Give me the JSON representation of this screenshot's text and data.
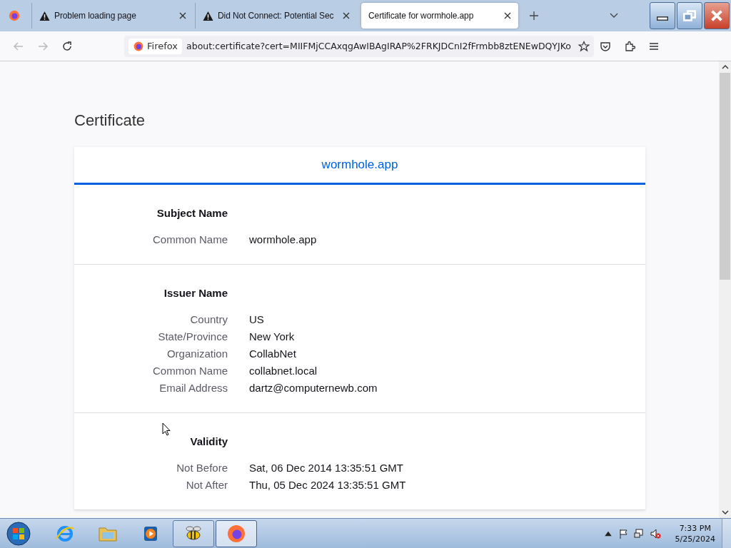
{
  "tabs": [
    {
      "title": "Problem loading page",
      "warning": true,
      "selected": false
    },
    {
      "title": "Did Not Connect: Potential Sec",
      "warning": true,
      "selected": false
    },
    {
      "title": "Certificate for wormhole.app",
      "warning": false,
      "selected": true
    }
  ],
  "nav": {
    "identity": "Firefox",
    "url": "about:certificate?cert=MIIFMjCCAxqgAwIBAgIRAP%2FRKJDCnI2fFrmbb8ztENEwDQYJKo"
  },
  "page": {
    "title": "Certificate",
    "cert_tab": "wormhole.app",
    "sections": [
      {
        "heading": "Subject Name",
        "rows": [
          {
            "label": "Common Name",
            "value": "wormhole.app"
          }
        ]
      },
      {
        "heading": "Issuer Name",
        "rows": [
          {
            "label": "Country",
            "value": "US"
          },
          {
            "label": "State/Province",
            "value": "New York"
          },
          {
            "label": "Organization",
            "value": "CollabNet"
          },
          {
            "label": "Common Name",
            "value": "collabnet.local"
          },
          {
            "label": "Email Address",
            "value": "dartz@computernewb.com"
          }
        ]
      },
      {
        "heading": "Validity",
        "rows": [
          {
            "label": "Not Before",
            "value": "Sat, 06 Dec 2014 13:35:51 GMT"
          },
          {
            "label": "Not After",
            "value": "Thu, 05 Dec 2024 13:35:51 GMT"
          }
        ]
      }
    ]
  },
  "taskbar": {
    "items": [
      {
        "kind": "ie",
        "running": false,
        "selected": false
      },
      {
        "kind": "folder",
        "running": false,
        "selected": false
      },
      {
        "kind": "media",
        "running": false,
        "selected": false
      },
      {
        "kind": "bee",
        "running": true,
        "selected": false
      },
      {
        "kind": "firefox",
        "running": true,
        "selected": true
      }
    ],
    "time": "7:33 PM",
    "date": "5/25/2024"
  }
}
